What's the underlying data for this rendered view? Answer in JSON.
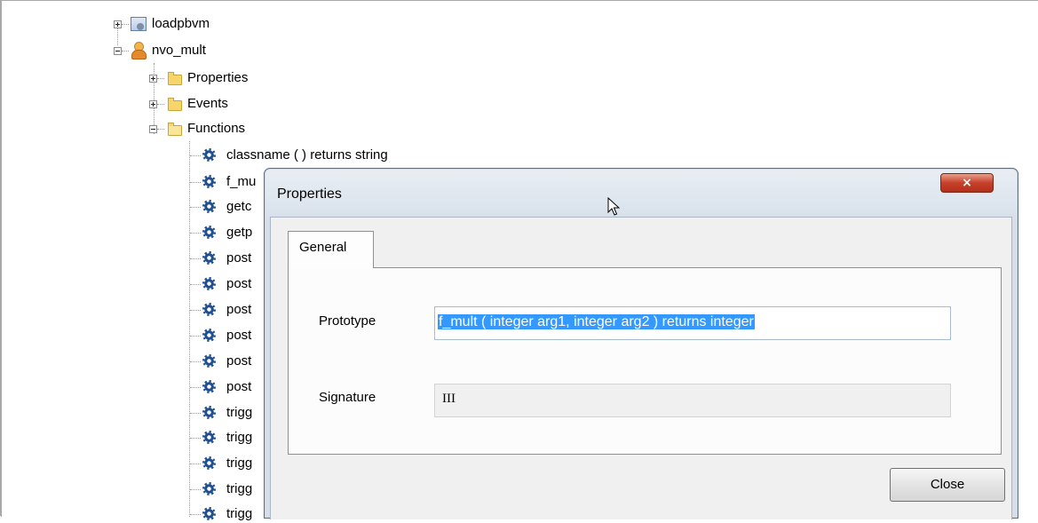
{
  "tree": {
    "app_node": {
      "label": "loadpbvm",
      "icon": "application-icon",
      "expanded": false
    },
    "object_node": {
      "label": "nvo_mult",
      "icon": "user-object-icon",
      "expanded": true
    },
    "folders": [
      {
        "label": "Properties",
        "expanded": false
      },
      {
        "label": "Events",
        "expanded": false
      },
      {
        "label": "Functions",
        "expanded": true
      }
    ],
    "functions": [
      "classname ( )  returns string",
      "f_mu",
      "getc",
      "getp",
      "post",
      "post",
      "post",
      "post",
      "post",
      "post",
      "trigg",
      "trigg",
      "trigg",
      "trigg",
      "trigg"
    ]
  },
  "dialog": {
    "title": "Properties",
    "close_icon": "×",
    "tabs": [
      {
        "label": "General",
        "active": true
      }
    ],
    "prototype_label": "Prototype",
    "prototype_value": "f_mult ( integer arg1, integer arg2 )  returns integer",
    "signature_label": "Signature",
    "signature_value": "III",
    "close_button": "Close"
  },
  "colors": {
    "selection": "#3399ff",
    "close_x": "#c7402a",
    "gear": "#1f4f8f"
  }
}
